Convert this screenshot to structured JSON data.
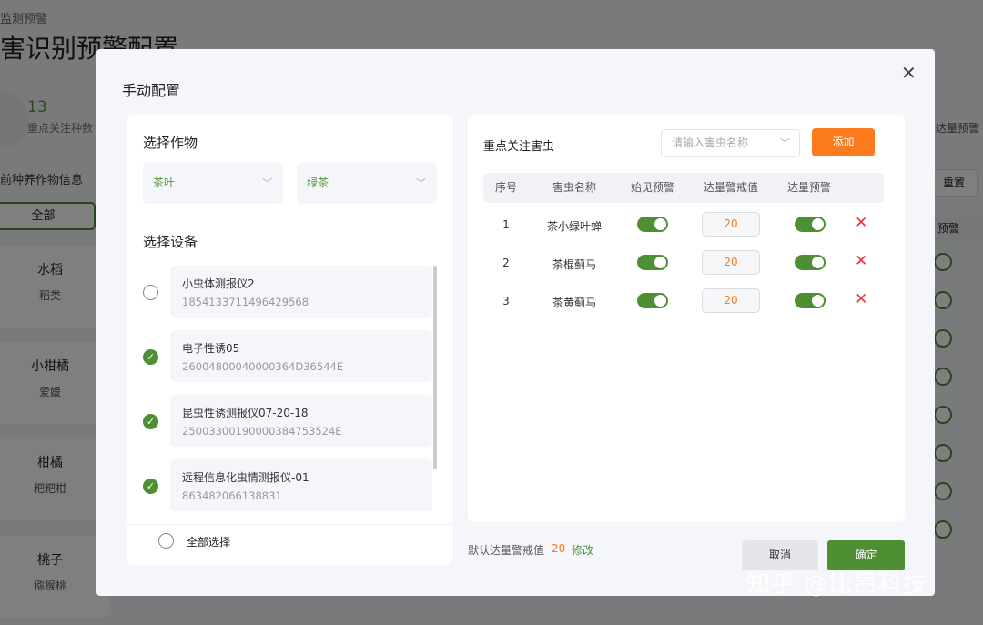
{
  "background": {
    "breadcrumb": "监测预警",
    "title": "害识别预警配置",
    "stat_value": "13",
    "stat_label": "重点关注种数",
    "section": "前种养作物信息",
    "all": "全部",
    "crops": [
      {
        "name": "水稻",
        "type": "稻类"
      },
      {
        "name": "小柑橘",
        "type": "爱媛"
      },
      {
        "name": "柑橘",
        "type": "粑粑柑"
      },
      {
        "name": "桃子",
        "type": "猕猴桃"
      }
    ],
    "right_label": "达量预警",
    "reset": "重置",
    "col": "预警"
  },
  "dialog": {
    "title": "手动配置",
    "crop_section": "选择作物",
    "crop": "茶叶",
    "variety": "绿茶",
    "device_section": "选择设备",
    "devices": [
      {
        "name": "小虫体测报仪2",
        "id": "1854133711496429568",
        "checked": false
      },
      {
        "name": "电子性诱05",
        "id": "26004800040000364D36544E",
        "checked": true
      },
      {
        "name": "昆虫性诱测报仪07-20-18",
        "id": "25003300190000384753524E",
        "checked": true
      },
      {
        "name": "远程信息化虫情测报仪-01",
        "id": "863482066138831",
        "checked": true
      }
    ],
    "select_all": "全部选择",
    "pest_section": "重点关注害虫",
    "search_placeholder": "请输入害虫名称",
    "add": "添加",
    "columns": [
      "序号",
      "害虫名称",
      "始见预警",
      "达量警戒值",
      "达量预警"
    ],
    "pests": [
      {
        "no": "1",
        "name": "茶小绿叶蝉",
        "first_warn": true,
        "threshold": "20",
        "amount_warn": true
      },
      {
        "no": "2",
        "name": "茶棍蓟马",
        "first_warn": true,
        "threshold": "20",
        "amount_warn": true
      },
      {
        "no": "3",
        "name": "茶黄蓟马",
        "first_warn": true,
        "threshold": "20",
        "amount_warn": true
      }
    ],
    "default_label": "默认达量警戒值",
    "default_value": "20",
    "edit": "修改",
    "cancel": "取消",
    "confirm": "确定"
  },
  "watermark": "知乎 @比昂科技"
}
